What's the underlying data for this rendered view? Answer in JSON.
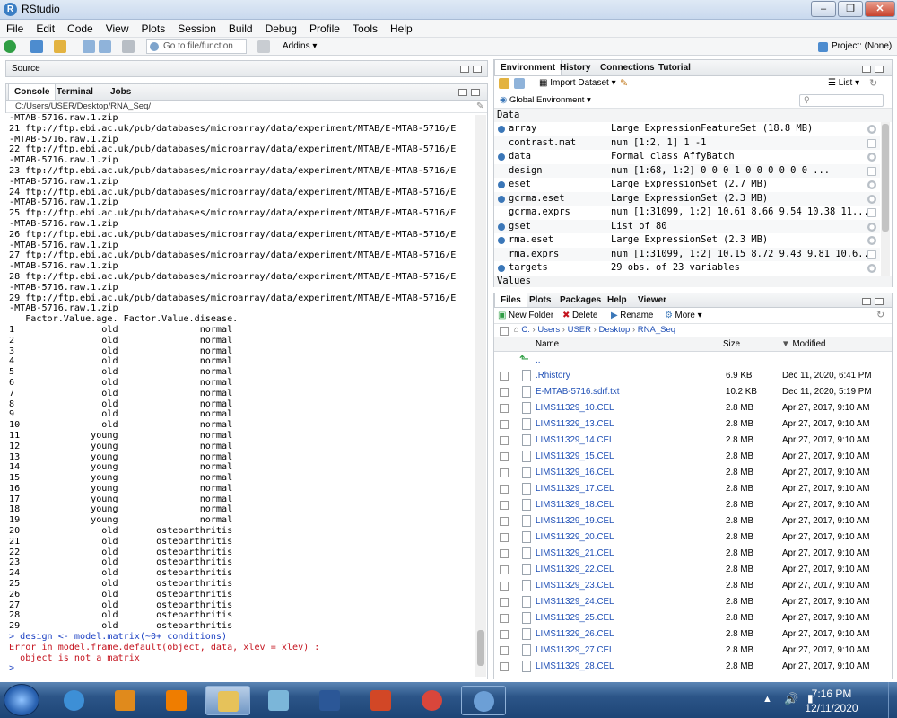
{
  "window": {
    "title": "RStudio"
  },
  "menu": [
    "File",
    "Edit",
    "Code",
    "View",
    "Plots",
    "Session",
    "Build",
    "Debug",
    "Profile",
    "Tools",
    "Help"
  ],
  "toolbar": {
    "goto_placeholder": "Go to file/function",
    "addins": "Addins",
    "project": "Project: (None)"
  },
  "source_pane": {
    "title": "Source"
  },
  "console_pane": {
    "tabs": [
      "Console",
      "Terminal",
      "Jobs"
    ],
    "path": "C:/Users/USER/Desktop/RNA_Seq/",
    "lines": [
      "-MTAB-5716.raw.1.zip",
      "21 ftp://ftp.ebi.ac.uk/pub/databases/microarray/data/experiment/MTAB/E-MTAB-5716/E",
      "-MTAB-5716.raw.1.zip",
      "22 ftp://ftp.ebi.ac.uk/pub/databases/microarray/data/experiment/MTAB/E-MTAB-5716/E",
      "-MTAB-5716.raw.1.zip",
      "23 ftp://ftp.ebi.ac.uk/pub/databases/microarray/data/experiment/MTAB/E-MTAB-5716/E",
      "-MTAB-5716.raw.1.zip",
      "24 ftp://ftp.ebi.ac.uk/pub/databases/microarray/data/experiment/MTAB/E-MTAB-5716/E",
      "-MTAB-5716.raw.1.zip",
      "25 ftp://ftp.ebi.ac.uk/pub/databases/microarray/data/experiment/MTAB/E-MTAB-5716/E",
      "-MTAB-5716.raw.1.zip",
      "26 ftp://ftp.ebi.ac.uk/pub/databases/microarray/data/experiment/MTAB/E-MTAB-5716/E",
      "-MTAB-5716.raw.1.zip",
      "27 ftp://ftp.ebi.ac.uk/pub/databases/microarray/data/experiment/MTAB/E-MTAB-5716/E",
      "-MTAB-5716.raw.1.zip",
      "28 ftp://ftp.ebi.ac.uk/pub/databases/microarray/data/experiment/MTAB/E-MTAB-5716/E",
      "-MTAB-5716.raw.1.zip",
      "29 ftp://ftp.ebi.ac.uk/pub/databases/microarray/data/experiment/MTAB/E-MTAB-5716/E",
      "-MTAB-5716.raw.1.zip",
      "   Factor.Value.age. Factor.Value.disease.",
      "1                old               normal",
      "2                old               normal",
      "3                old               normal",
      "4                old               normal",
      "5                old               normal",
      "6                old               normal",
      "7                old               normal",
      "8                old               normal",
      "9                old               normal",
      "10               old               normal",
      "11             young               normal",
      "12             young               normal",
      "13             young               normal",
      "14             young               normal",
      "15             young               normal",
      "16             young               normal",
      "17             young               normal",
      "18             young               normal",
      "19             young               normal",
      "20               old       osteoarthritis",
      "21               old       osteoarthritis",
      "22               old       osteoarthritis",
      "23               old       osteoarthritis",
      "24               old       osteoarthritis",
      "25               old       osteoarthritis",
      "26               old       osteoarthritis",
      "27               old       osteoarthritis",
      "28               old       osteoarthritis",
      "29               old       osteoarthritis"
    ],
    "command": "> design <- model.matrix(~0+ conditions)",
    "error_lines": [
      "Error in model.frame.default(object, data, xlev = xlev) :",
      "  object is not a matrix"
    ],
    "prompt": ">"
  },
  "env_pane": {
    "tabs": [
      "Environment",
      "History",
      "Connections",
      "Tutorial"
    ],
    "import_label": "Import Dataset",
    "list_label": "List",
    "scope": "Global Environment",
    "section_data": "Data",
    "section_values": "Values",
    "rows": [
      {
        "name": "array",
        "value": "Large ExpressionFeatureSet (18.8 MB)",
        "expandable": true
      },
      {
        "name": "contrast.mat",
        "value": "num [1:2, 1] 1 -1",
        "expandable": false
      },
      {
        "name": "data",
        "value": "Formal class AffyBatch",
        "expandable": true
      },
      {
        "name": "design",
        "value": "num [1:68, 1:2] 0 0 0 1 0 0 0 0 0 0 ...",
        "expandable": false
      },
      {
        "name": "eset",
        "value": "Large ExpressionSet (2.7 MB)",
        "expandable": true
      },
      {
        "name": "gcrma.eset",
        "value": "Large ExpressionSet (2.3 MB)",
        "expandable": true
      },
      {
        "name": "gcrma.exprs",
        "value": "num [1:31099, 1:2] 10.61 8.66 9.54 10.38 11...",
        "expandable": false
      },
      {
        "name": "gset",
        "value": "List of 80",
        "expandable": true
      },
      {
        "name": "rma.eset",
        "value": "Large ExpressionSet (2.3 MB)",
        "expandable": true
      },
      {
        "name": "rma.exprs",
        "value": "num [1:31099, 1:2] 10.15 8.72 9.43 9.81 10.6...",
        "expandable": false
      },
      {
        "name": "targets",
        "value": "29 obs. of 23 variables",
        "expandable": true
      }
    ]
  },
  "files_pane": {
    "tabs": [
      "Files",
      "Plots",
      "Packages",
      "Help",
      "Viewer"
    ],
    "actions": [
      "New Folder",
      "Delete",
      "Rename",
      "More"
    ],
    "breadcrumb": [
      "C:",
      "Users",
      "USER",
      "Desktop",
      "RNA_Seq"
    ],
    "columns": [
      "Name",
      "Size",
      "Modified"
    ],
    "parent_label": "..",
    "files": [
      {
        "name": ".Rhistory",
        "size": "6.9 KB",
        "modified": "Dec 11, 2020, 6:41 PM"
      },
      {
        "name": "E-MTAB-5716.sdrf.txt",
        "size": "10.2 KB",
        "modified": "Dec 11, 2020, 5:19 PM"
      },
      {
        "name": "LIMS11329_10.CEL",
        "size": "2.8 MB",
        "modified": "Apr 27, 2017, 9:10 AM"
      },
      {
        "name": "LIMS11329_13.CEL",
        "size": "2.8 MB",
        "modified": "Apr 27, 2017, 9:10 AM"
      },
      {
        "name": "LIMS11329_14.CEL",
        "size": "2.8 MB",
        "modified": "Apr 27, 2017, 9:10 AM"
      },
      {
        "name": "LIMS11329_15.CEL",
        "size": "2.8 MB",
        "modified": "Apr 27, 2017, 9:10 AM"
      },
      {
        "name": "LIMS11329_16.CEL",
        "size": "2.8 MB",
        "modified": "Apr 27, 2017, 9:10 AM"
      },
      {
        "name": "LIMS11329_17.CEL",
        "size": "2.8 MB",
        "modified": "Apr 27, 2017, 9:10 AM"
      },
      {
        "name": "LIMS11329_18.CEL",
        "size": "2.8 MB",
        "modified": "Apr 27, 2017, 9:10 AM"
      },
      {
        "name": "LIMS11329_19.CEL",
        "size": "2.8 MB",
        "modified": "Apr 27, 2017, 9:10 AM"
      },
      {
        "name": "LIMS11329_20.CEL",
        "size": "2.8 MB",
        "modified": "Apr 27, 2017, 9:10 AM"
      },
      {
        "name": "LIMS11329_21.CEL",
        "size": "2.8 MB",
        "modified": "Apr 27, 2017, 9:10 AM"
      },
      {
        "name": "LIMS11329_22.CEL",
        "size": "2.8 MB",
        "modified": "Apr 27, 2017, 9:10 AM"
      },
      {
        "name": "LIMS11329_23.CEL",
        "size": "2.8 MB",
        "modified": "Apr 27, 2017, 9:10 AM"
      },
      {
        "name": "LIMS11329_24.CEL",
        "size": "2.8 MB",
        "modified": "Apr 27, 2017, 9:10 AM"
      },
      {
        "name": "LIMS11329_25.CEL",
        "size": "2.8 MB",
        "modified": "Apr 27, 2017, 9:10 AM"
      },
      {
        "name": "LIMS11329_26.CEL",
        "size": "2.8 MB",
        "modified": "Apr 27, 2017, 9:10 AM"
      },
      {
        "name": "LIMS11329_27.CEL",
        "size": "2.8 MB",
        "modified": "Apr 27, 2017, 9:10 AM"
      },
      {
        "name": "LIMS11329_28.CEL",
        "size": "2.8 MB",
        "modified": "Apr 27, 2017, 9:10 AM"
      }
    ]
  },
  "taskbar": {
    "apps": [
      "internet-explorer",
      "media-player",
      "vlc",
      "file-explorer",
      "notepad",
      "word",
      "office",
      "chrome",
      "r"
    ],
    "time": "7:16 PM",
    "date": "12/11/2020"
  },
  "colors": {
    "accent": "#3b77b8",
    "link": "#1f4fb5",
    "error": "#c4141f",
    "command": "#1a3fc2"
  }
}
